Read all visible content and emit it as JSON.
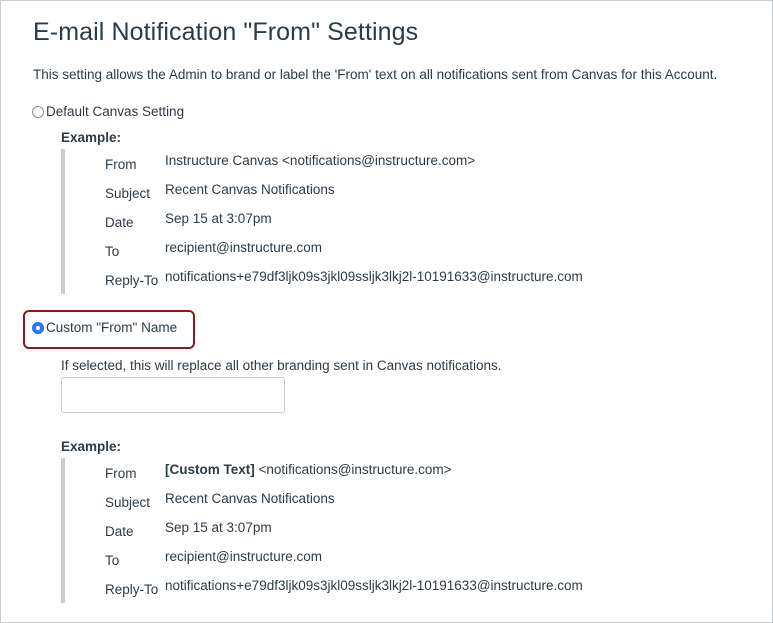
{
  "page": {
    "title": "E-mail Notification \"From\" Settings",
    "description": "This setting allows the Admin to brand or label the 'From' text on all notifications sent from Canvas for this Account."
  },
  "options": {
    "default": {
      "label": "Default Canvas Setting",
      "checked": false
    },
    "custom": {
      "label": "Custom \"From\" Name",
      "checked": true,
      "help": "If selected, this will replace all other branding sent in Canvas notifications.",
      "input_value": "",
      "input_placeholder": ""
    }
  },
  "example_label": "Example:",
  "default_example": {
    "from_key": "From",
    "from_value": "Instructure Canvas <notifications@instructure.com>",
    "subject_key": "Subject",
    "subject_value": "Recent Canvas Notifications",
    "date_key": "Date",
    "date_value": "Sep 15 at 3:07pm",
    "to_key": "To",
    "to_value": "recipient@instructure.com",
    "replyto_key": "Reply-To",
    "replyto_value": "notifications+e79df3ljk09s3jkl09ssljk3lkj2l-10191633@instructure.com"
  },
  "custom_example": {
    "from_key": "From",
    "from_custom": "[Custom Text]",
    "from_address": "<notifications@instructure.com>",
    "subject_key": "Subject",
    "subject_value": "Recent Canvas Notifications",
    "date_key": "Date",
    "date_value": "Sep 15 at 3:07pm",
    "to_key": "To",
    "to_value": "recipient@instructure.com",
    "replyto_key": "Reply-To",
    "replyto_value": "notifications+e79df3ljk09s3jkl09ssljk3lkj2l-10191633@instructure.com"
  },
  "colors": {
    "highlight_border": "#8b1a1a",
    "radio_selected": "#2d7cf6",
    "text": "#2d3b45",
    "rule": "#c7cdd1"
  }
}
